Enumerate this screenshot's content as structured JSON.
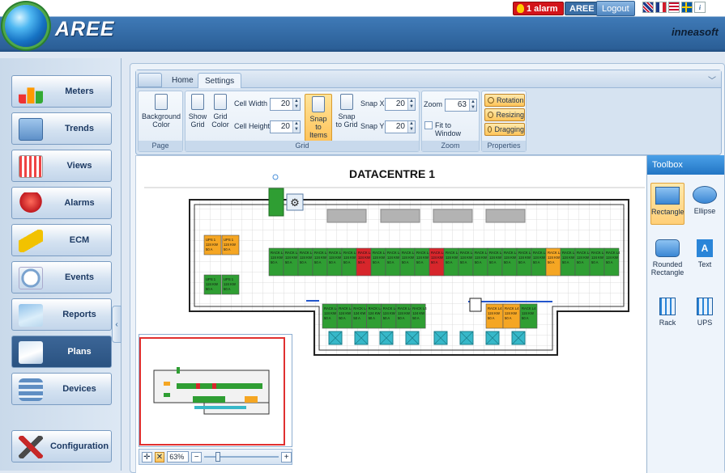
{
  "app": {
    "title": "AREE",
    "vendor": "inneasoft"
  },
  "topbar": {
    "alarm_label": "1 alarm",
    "user_label": "AREE",
    "logout_label": "Logout"
  },
  "sidebar": {
    "items": [
      {
        "label": "Meters"
      },
      {
        "label": "Trends"
      },
      {
        "label": "Views"
      },
      {
        "label": "Alarms"
      },
      {
        "label": "ECM"
      },
      {
        "label": "Events"
      },
      {
        "label": "Reports"
      },
      {
        "label": "Plans",
        "active": true
      },
      {
        "label": "Devices"
      },
      {
        "label": "Configuration"
      }
    ]
  },
  "ribbon": {
    "tabs": [
      {
        "label": "Home"
      },
      {
        "label": "Settings",
        "selected": true
      }
    ],
    "page": {
      "caption": "Page",
      "background_color": "Background Color"
    },
    "grid": {
      "caption": "Grid",
      "show_grid": "Show Grid",
      "grid_color": "Grid Color",
      "cell_width_label": "Cell Width",
      "cell_width": "20",
      "cell_height_label": "Cell Height",
      "cell_height": "20",
      "snap_to_items": "Snap to Items",
      "snap_to_grid": "Snap to Grid",
      "snap_x_label": "Snap X",
      "snap_x": "20",
      "snap_y_label": "Snap Y",
      "snap_y": "20"
    },
    "zoom": {
      "caption": "Zoom",
      "zoom_label": "Zoom",
      "zoom_value": "63",
      "fit_label": "Fit to Window"
    },
    "properties": {
      "caption": "Properties",
      "rotation": "Rotation",
      "resizing": "Resizing",
      "dragging": "Dragging"
    }
  },
  "plan": {
    "title": "DATACENTRE 1",
    "ups_label": "UPS 1",
    "ups_sub": "124 KW",
    "ups_amp": "50 A",
    "rack_label": "RACK L4",
    "rack_sub": "124 KW",
    "rack_amp": "50 A"
  },
  "minimap": {
    "zoom_value": "63%"
  },
  "toolbox": {
    "title": "Toolbox",
    "tools": [
      {
        "label": "Rectangle"
      },
      {
        "label": "Ellipse"
      },
      {
        "label": "Rounded Rectangle"
      },
      {
        "label": "Text"
      },
      {
        "label": "Rack"
      },
      {
        "label": "UPS"
      }
    ]
  },
  "colors": {
    "accent": "#2b5f97",
    "rack_green": "#2f9e33",
    "rack_red": "#d7262b",
    "ups_orange": "#f5a623",
    "cooling_cyan": "#37b8c9"
  }
}
